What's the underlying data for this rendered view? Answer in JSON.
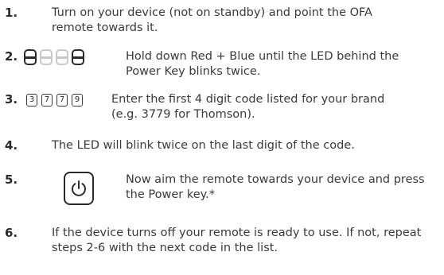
{
  "steps": [
    {
      "number": "1.",
      "lines": [
        "Turn on your device (not on standby) and point the OFA",
        "remote towards it."
      ]
    },
    {
      "number": "2.",
      "lines": [
        "Hold down Red + Blue until the LED behind the",
        "Power Key blinks twice."
      ],
      "buttons": [
        "dark",
        "light",
        "light",
        "dark"
      ]
    },
    {
      "number": "3.",
      "lines": [
        "Enter the first 4 digit code listed for your brand",
        "(e.g. 3779 for Thomson)."
      ],
      "keys": [
        "3",
        "7",
        "7",
        "9"
      ]
    },
    {
      "number": "4.",
      "lines": [
        "The LED will blink twice on the last digit of the code."
      ]
    },
    {
      "number": "5.",
      "lines": [
        "Now aim the remote towards your device and press",
        "the Power key.*"
      ],
      "icon": "power-icon"
    },
    {
      "number": "6.",
      "lines": [
        "If the device turns off your remote is ready to use. If not, repeat",
        "steps 2-6 with the next code in the list."
      ]
    }
  ]
}
